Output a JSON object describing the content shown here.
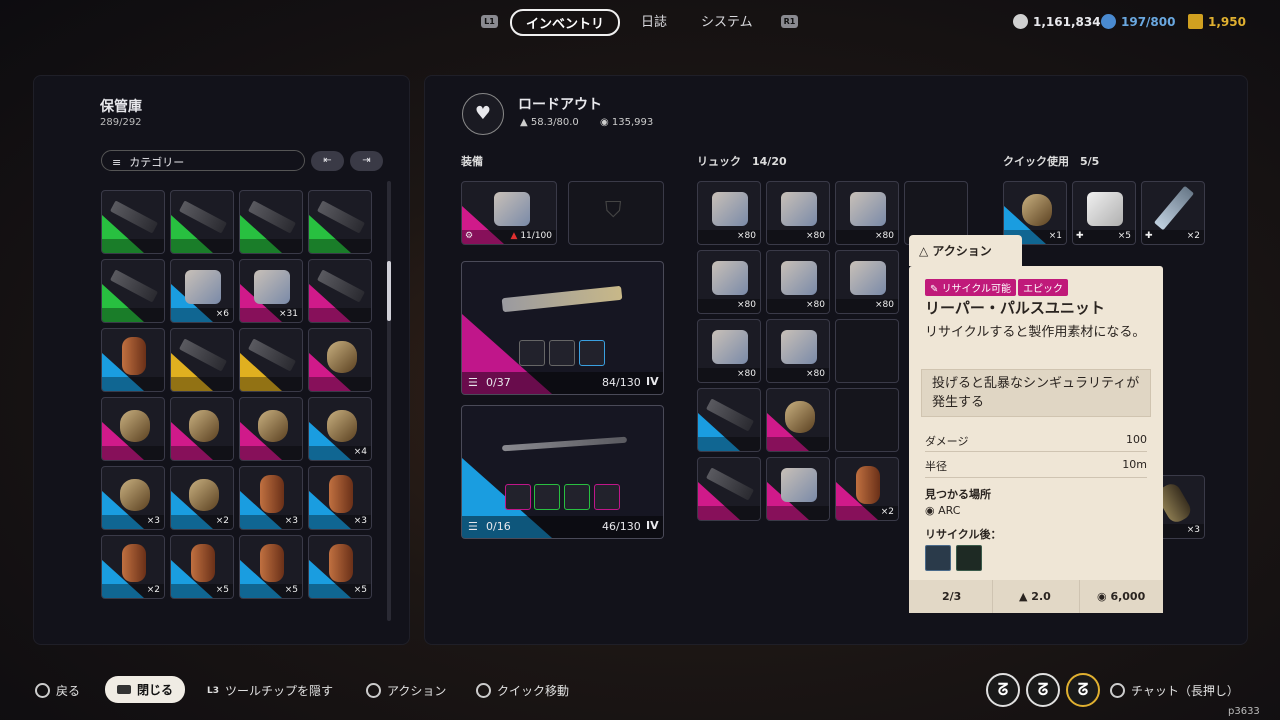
{
  "topbar": {
    "l1": "L1",
    "r1": "R1",
    "tabs": [
      "インベントリ",
      "日誌",
      "システム"
    ],
    "currencies": {
      "coins": "1,161,834",
      "capacity": "197/800",
      "tokens": "1,950"
    }
  },
  "storage": {
    "title": "保管庫",
    "count": "289/292",
    "filter_label": "カテゴリー",
    "sort_a": "⇤",
    "sort_b": "⇥",
    "rows": [
      [
        {
          "q": "",
          "c": "green",
          "t": "gun"
        },
        {
          "q": "",
          "c": "green",
          "t": "gun"
        },
        {
          "q": "",
          "c": "green",
          "t": "gun"
        },
        {
          "q": "",
          "c": "green",
          "t": "gun"
        }
      ],
      [
        {
          "q": "",
          "c": "green",
          "t": "gun"
        },
        {
          "q": "×6",
          "c": "blue",
          "t": "box"
        },
        {
          "q": "×31",
          "c": "",
          "t": "box"
        },
        {
          "q": "",
          "c": "",
          "t": "gun"
        }
      ],
      [
        {
          "q": "",
          "c": "blue",
          "t": "can"
        },
        {
          "q": "",
          "c": "yellow",
          "t": "gun"
        },
        {
          "q": "",
          "c": "yellow",
          "t": "gun"
        },
        {
          "q": "",
          "c": "",
          "t": "grn"
        }
      ],
      [
        {
          "q": "",
          "c": "",
          "t": "grn"
        },
        {
          "q": "",
          "c": "",
          "t": "grn"
        },
        {
          "q": "",
          "c": "",
          "t": "grn"
        },
        {
          "q": "×4",
          "c": "blue",
          "t": "grn"
        }
      ],
      [
        {
          "q": "×3",
          "c": "blue",
          "t": "grn"
        },
        {
          "q": "×2",
          "c": "blue",
          "t": "grn"
        },
        {
          "q": "×3",
          "c": "blue",
          "t": "can"
        },
        {
          "q": "×3",
          "c": "blue",
          "t": "can"
        }
      ],
      [
        {
          "q": "×2",
          "c": "blue",
          "t": "can"
        },
        {
          "q": "×5",
          "c": "blue",
          "t": "can"
        },
        {
          "q": "×5",
          "c": "blue",
          "t": "can"
        },
        {
          "q": "×5",
          "c": "blue",
          "t": "can"
        }
      ]
    ]
  },
  "loadout": {
    "title": "ロードアウト",
    "weight": "58.3/80.0",
    "value": "135,993",
    "equip_label": "装備",
    "backpack_durability": "11/100",
    "weapon1": {
      "ammo": "0/37",
      "durability": "84/130",
      "tier": "IV"
    },
    "weapon2": {
      "ammo": "0/16",
      "durability": "46/130",
      "tier": "IV"
    },
    "bag_label": "リュック",
    "bag_count": "14/20",
    "quick_label": "クイック使用",
    "quick_count": "5/5",
    "bag_qty": [
      "×80",
      "×80",
      "×80",
      "×80",
      "×80",
      "×80",
      "×80",
      "×80"
    ],
    "quick_qty": [
      "×1",
      "×5",
      "×2"
    ],
    "extra_qty": [
      "×2",
      "×3"
    ]
  },
  "tooltip": {
    "tab_label": "アクション",
    "badge1": "リサイクル可能",
    "badge2": "エピック",
    "name": "リーパー・パルスユニット",
    "desc": "リサイクルすると製作用素材になる。",
    "flavor": "投げると乱暴なシンギュラリティが発生する",
    "damage_label": "ダメージ",
    "damage": "100",
    "radius_label": "半径",
    "radius": "10m",
    "found_label": "見つかる場所",
    "found": "ARC",
    "recycle_label": "リサイクル後：",
    "stack": "2/3",
    "weight": "2.0",
    "price": "6,000"
  },
  "bottom": {
    "back": "戻る",
    "close": "閉じる",
    "l3": "L3",
    "hide_tooltip": "ツールチップを隠す",
    "action": "アクション",
    "quick_move": "クイック移動",
    "chat": "チャット（長押し）",
    "id": "p3633"
  },
  "colors": {
    "epic": "#d01a8a",
    "rare": "#1a9de0",
    "uncommon": "#28c040",
    "legendary": "#e0b020"
  }
}
